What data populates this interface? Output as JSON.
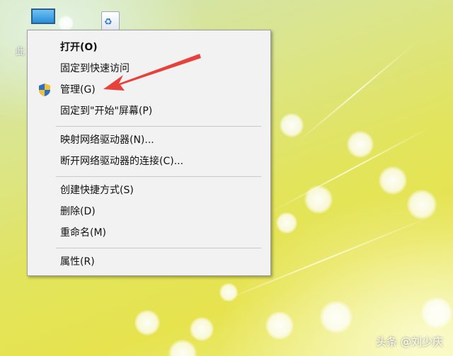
{
  "desktop": {
    "icon_label_partial": "此"
  },
  "context_menu": {
    "items": [
      {
        "id": "open",
        "label": "打开(O)",
        "bold": true
      },
      {
        "id": "pin-quick-access",
        "label": "固定到快速访问"
      },
      {
        "id": "manage",
        "label": "管理(G)",
        "icon": "uac-shield-icon"
      },
      {
        "id": "pin-start",
        "label": "固定到\"开始\"屏幕(P)"
      },
      {
        "id": "map-drive",
        "label": "映射网络驱动器(N)..."
      },
      {
        "id": "disconnect-drive",
        "label": "断开网络驱动器的连接(C)..."
      },
      {
        "id": "create-shortcut",
        "label": "创建快捷方式(S)"
      },
      {
        "id": "delete",
        "label": "删除(D)"
      },
      {
        "id": "rename",
        "label": "重命名(M)"
      },
      {
        "id": "properties",
        "label": "属性(R)"
      }
    ]
  },
  "annotation": {
    "color": "#e8403a",
    "points_to": "manage"
  },
  "watermark": {
    "text": "头条 @刘少庆"
  },
  "colors": {
    "menu_bg": "#f2f2f2",
    "menu_border": "#a0a0a0",
    "shield_blue": "#2a6fc9",
    "shield_yellow": "#f2c230"
  }
}
